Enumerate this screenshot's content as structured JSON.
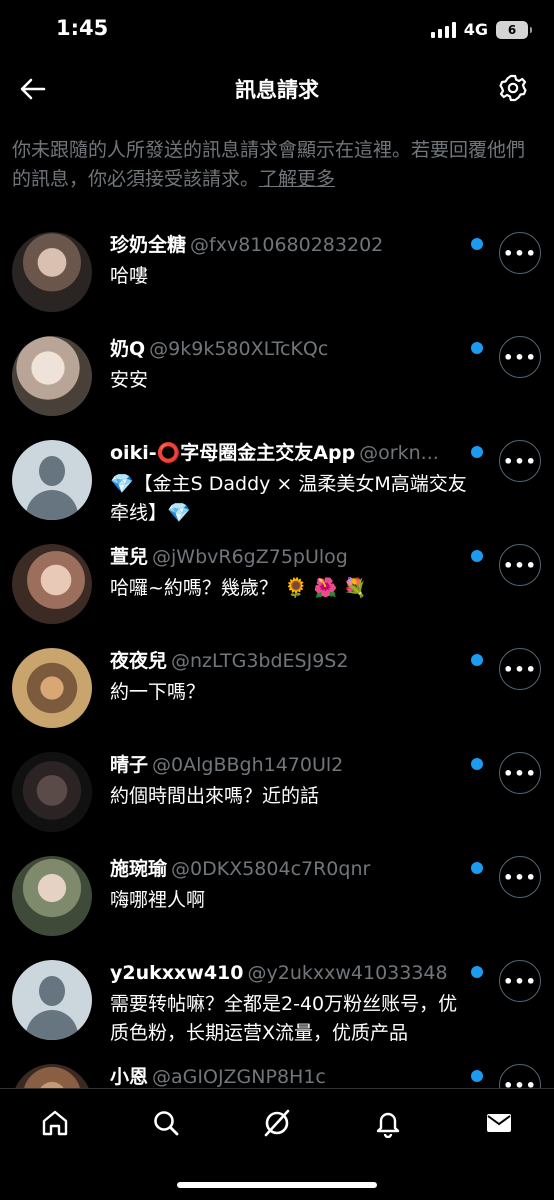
{
  "status_bar": {
    "time": "1:45",
    "network": "4G",
    "battery": "6"
  },
  "header": {
    "title": "訊息請求"
  },
  "notice": {
    "text": "你未跟隨的人所發送的訊息請求會顯示在這裡。若要回覆他們的訊息，你必須接受該請求。",
    "link": "了解更多"
  },
  "requests": [
    {
      "name": "珍奶全糖",
      "handle": "@fxv810680283202",
      "message": "哈嘍"
    },
    {
      "name": "奶Q",
      "handle": "@9k9k580XLTcKQc",
      "message": "安安"
    },
    {
      "name": "oiki-⭕字母圈金主交友App",
      "handle": "@orkn...",
      "message": "💎【金主S Daddy × 温柔美女M高端交友牵线】💎"
    },
    {
      "name": "萱兒",
      "handle": "@jWbvR6gZ75pUlog",
      "message": "哈囉~約嗎？幾歲？ 🌻 🌺 💐"
    },
    {
      "name": "夜夜兒",
      "handle": "@nzLTG3bdESJ9S2",
      "message": "約一下嗎？"
    },
    {
      "name": "晴子",
      "handle": "@0AlgBBgh1470Ul2",
      "message": "約個時間出來嗎？近的話"
    },
    {
      "name": "施琬瑜",
      "handle": "@0DKX5804c7R0qnr",
      "message": "嗨哪裡人啊"
    },
    {
      "name": "y2ukxxw410",
      "handle": "@y2ukxxw41033348",
      "message": "需要转帖嘛？全都是2-40万粉丝账号，优质色粉，长期运营X流量，优质产品"
    },
    {
      "name": "小恩",
      "handle": "@aGIOJZGNP8H1c",
      "message": ""
    }
  ],
  "more_label": "•••",
  "colors": {
    "background": "#000000",
    "accent": "#1d9bf0",
    "muted": "#71767b"
  }
}
